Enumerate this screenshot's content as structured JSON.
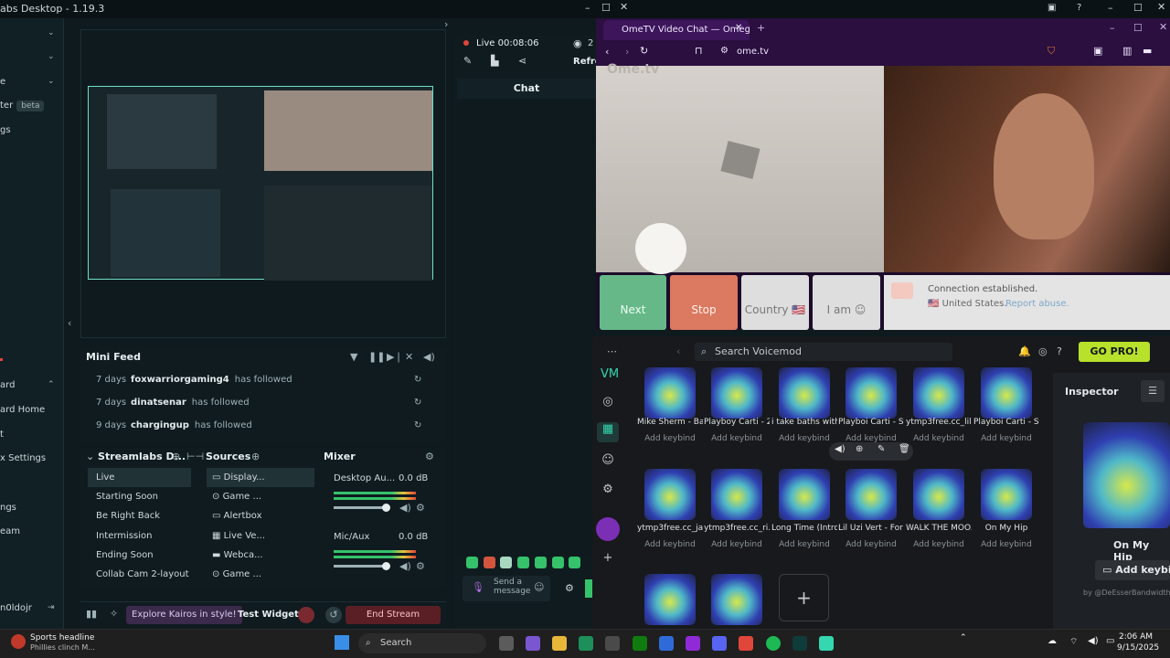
{
  "streamlabs": {
    "title": "abs Desktop - 1.19.3",
    "left_menu": [
      {
        "label": "e",
        "top": 0
      },
      {
        "label": "ter",
        "beta": "beta"
      },
      {
        "label": "gs"
      },
      {
        "label": "ard"
      },
      {
        "label": "ard Home"
      },
      {
        "label": "t"
      },
      {
        "label": "x Settings"
      },
      {
        "label": "ngs"
      },
      {
        "label": "eam"
      },
      {
        "label": "n0ldojr"
      }
    ],
    "live": {
      "time": "Live 00:08:06",
      "viewers": "2",
      "refresh": "Refre"
    },
    "chat": {
      "title": "Chat",
      "message_placeholder": "Send a message"
    },
    "mini_feed": {
      "title": "Mini Feed",
      "rows": [
        {
          "days": "7 days",
          "user": "foxwarriorgaming4",
          "action": "has followed"
        },
        {
          "days": "7 days",
          "user": "dinatsenar",
          "action": "has followed"
        },
        {
          "days": "9 days",
          "user": "chargingup",
          "action": "has followed"
        }
      ]
    },
    "scenes": {
      "title": "Streamlabs D...",
      "items": [
        "Live",
        "Starting Soon",
        "Be Right Back",
        "Intermission",
        "Ending Soon",
        "Collab Cam 2-layout"
      ]
    },
    "sources": {
      "title": "Sources",
      "items": [
        "Display...",
        "Game ...",
        "Alertbox",
        "Live Ve...",
        "Webca...",
        "Game ..."
      ]
    },
    "mixer": {
      "title": "Mixer",
      "channels": [
        {
          "name": "Desktop Au...",
          "db": "0.0 dB",
          "level": 0.9
        },
        {
          "name": "Mic/Aux",
          "db": "0.0 dB",
          "level": 0.9
        }
      ]
    },
    "bottom": {
      "kairos": "Explore Kairos in style!",
      "test_widgets": "Test Widgets",
      "end_stream": "End Stream"
    }
  },
  "browser": {
    "tab_title": "OmeTV Video Chat — Omeg",
    "url": "ome.tv",
    "buttons": {
      "next": "Next",
      "stop": "Stop",
      "country": "Country",
      "iam": "I am"
    },
    "status": {
      "line1": "Connection established.",
      "country": "United States.",
      "report": "Report abuse."
    }
  },
  "voicemod": {
    "search_placeholder": "Search Voicemod",
    "go_pro": "GO PRO!",
    "inspector_title": "Inspector",
    "inspector_name": "On My Hip",
    "inspector_keybind": "Add keybin",
    "inspector_credit": "by @DeEsserBandwidthOver",
    "sounds_row1": [
      "Mike Sherm - Ba...",
      "Playboy Carti - 2...",
      "i take baths with...",
      "Playboi Carti - St...",
      "ytmp3free.cc_lil...",
      "Playboi Carti - St..."
    ],
    "sounds_row2": [
      "ytmp3free.cc_ja...",
      "ytmp3free.cc_ri...",
      "Long Time (Intro)",
      "Lil Uzi Vert - For ...",
      "WALK THE MOO...",
      "On My Hip"
    ],
    "keybind_label": "Add keybind"
  },
  "taskbar": {
    "news_title": "Sports headline",
    "news_sub": "Phillies clinch M...",
    "search": "Search",
    "time": "2:06 AM",
    "date": "9/15/2025"
  },
  "colors": {
    "accent_green": "#6fe0c4",
    "end_stream": "#5a1f24",
    "go_pro": "#b7e12a",
    "ome_next": "#67b889",
    "ome_stop": "#db7961"
  }
}
